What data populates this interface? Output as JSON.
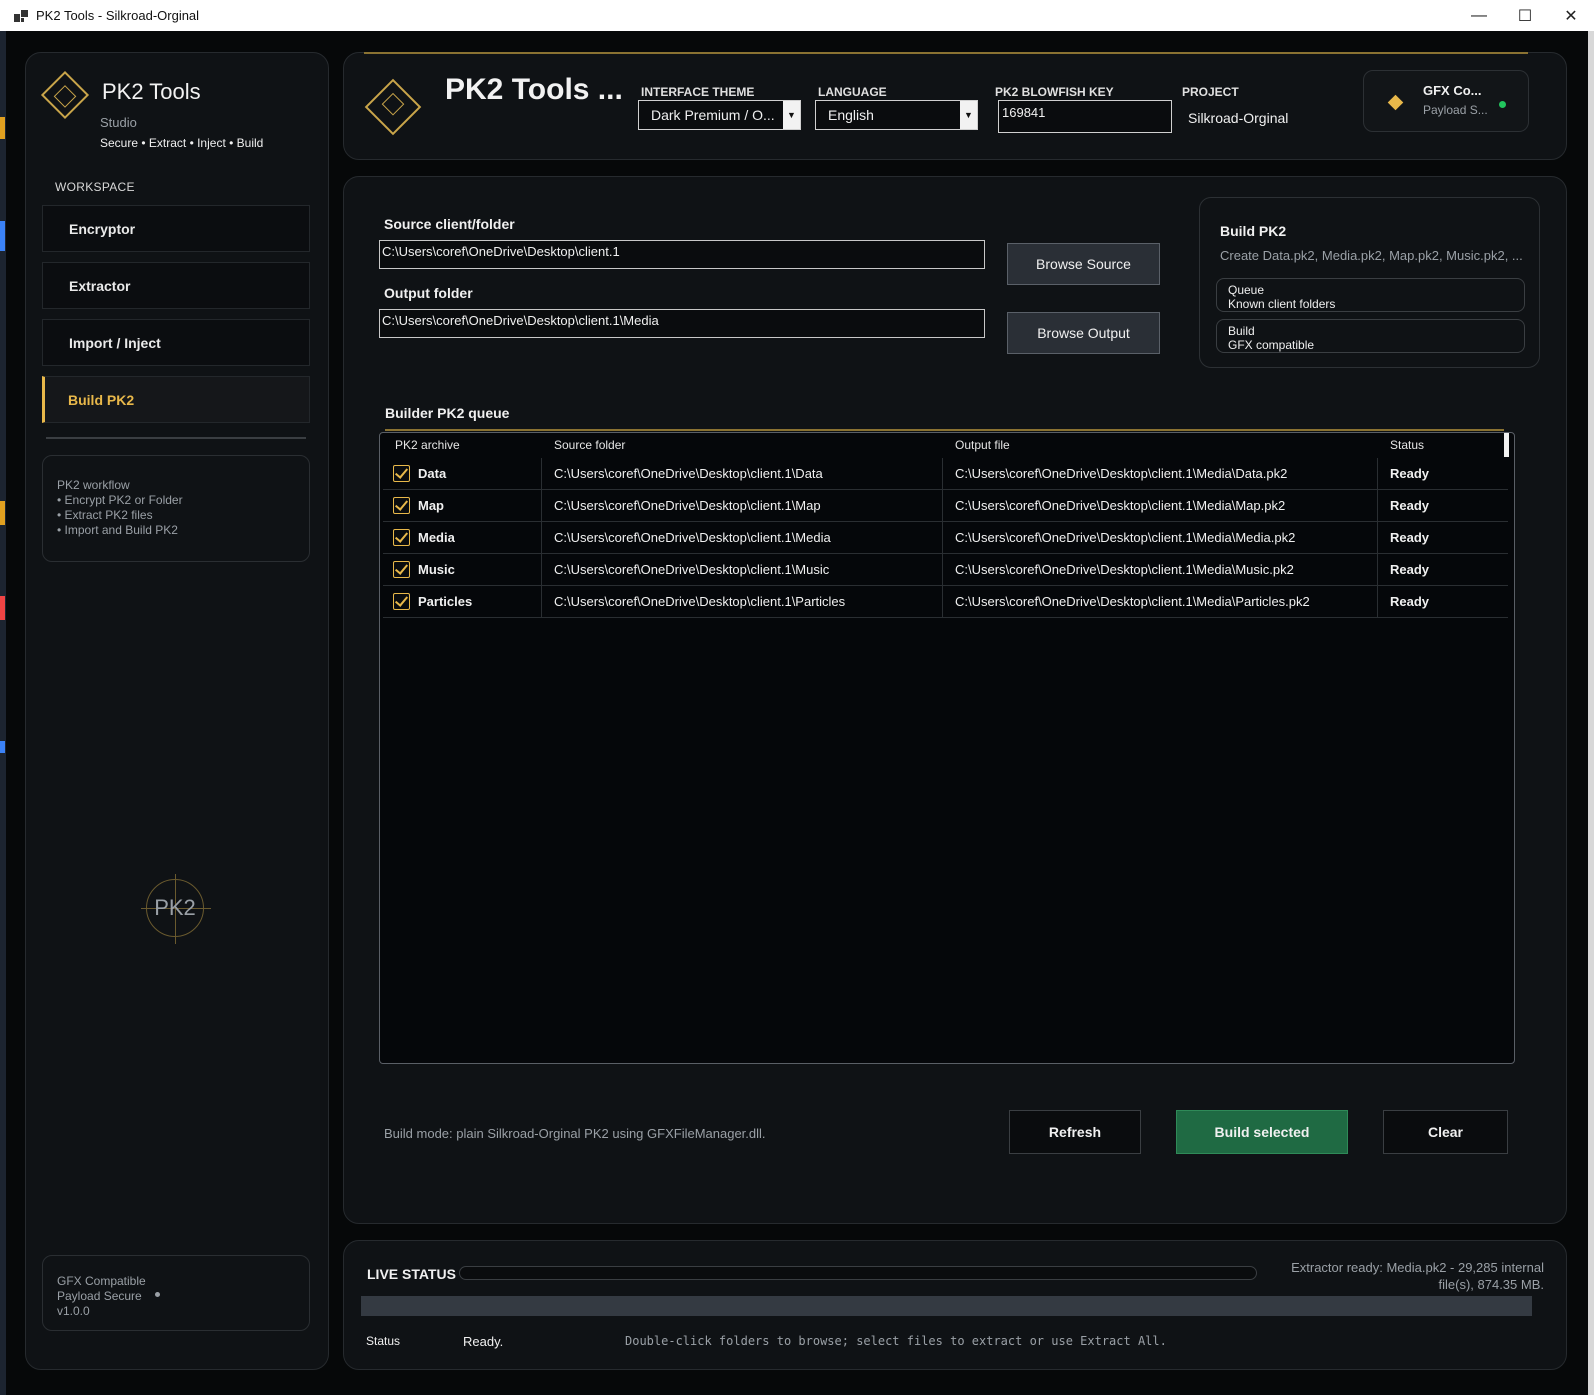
{
  "window": {
    "title": "PK2 Tools - Silkroad-Orginal",
    "minimize": "—",
    "maximize": "☐",
    "close": "✕"
  },
  "sidebar": {
    "app_name": "PK2 Tools",
    "subtitle": "Studio",
    "tagline": "Secure • Extract • Inject • Build",
    "section": "WORKSPACE",
    "items": [
      {
        "label": "Encryptor"
      },
      {
        "label": "Extractor"
      },
      {
        "label": "Import / Inject"
      },
      {
        "label": "Build PK2"
      }
    ],
    "active_index": 3,
    "workflow": [
      "PK2 workflow",
      "• Encrypt PK2 or Folder",
      "• Extract PK2 files",
      "• Import and Build PK2"
    ],
    "mark": "PK2",
    "footer": [
      "GFX Compatible",
      "Payload Secure",
      "v1.0.0"
    ]
  },
  "header": {
    "title": "PK2 Tools ...",
    "theme_label": "INTERFACE THEME",
    "theme_value": "Dark Premium / O...",
    "language_label": "LANGUAGE",
    "language_value": "English",
    "key_label": "PK2 BLOWFISH KEY",
    "key_value": "169841",
    "project_label": "PROJECT",
    "project_value": "Silkroad-Orginal",
    "gfx_title": "GFX Co...",
    "gfx_sub": "Payload S..."
  },
  "main": {
    "source_label": "Source client/folder",
    "source_value": "C:\\Users\\coref\\OneDrive\\Desktop\\client.1",
    "browse_source": "Browse Source",
    "output_label": "Output folder",
    "output_value": "C:\\Users\\coref\\OneDrive\\Desktop\\client.1\\Media",
    "browse_output": "Browse Output",
    "build_card": {
      "title": "Build PK2",
      "subtitle": "Create Data.pk2, Media.pk2, Map.pk2, Music.pk2, ...",
      "pills": [
        {
          "title": "Queue",
          "sub": "Known client folders"
        },
        {
          "title": "Build",
          "sub": "GFX compatible"
        }
      ]
    },
    "queue_title": "Builder PK2 queue",
    "columns": [
      "PK2 archive",
      "Source folder",
      "Output file",
      "Status"
    ],
    "rows": [
      {
        "archive": "Data",
        "source": "C:\\Users\\coref\\OneDrive\\Desktop\\client.1\\Data",
        "output": "C:\\Users\\coref\\OneDrive\\Desktop\\client.1\\Media\\Data.pk2",
        "status": "Ready"
      },
      {
        "archive": "Map",
        "source": "C:\\Users\\coref\\OneDrive\\Desktop\\client.1\\Map",
        "output": "C:\\Users\\coref\\OneDrive\\Desktop\\client.1\\Media\\Map.pk2",
        "status": "Ready"
      },
      {
        "archive": "Media",
        "source": "C:\\Users\\coref\\OneDrive\\Desktop\\client.1\\Media",
        "output": "C:\\Users\\coref\\OneDrive\\Desktop\\client.1\\Media\\Media.pk2",
        "status": "Ready"
      },
      {
        "archive": "Music",
        "source": "C:\\Users\\coref\\OneDrive\\Desktop\\client.1\\Music",
        "output": "C:\\Users\\coref\\OneDrive\\Desktop\\client.1\\Media\\Music.pk2",
        "status": "Ready"
      },
      {
        "archive": "Particles",
        "source": "C:\\Users\\coref\\OneDrive\\Desktop\\client.1\\Particles",
        "output": "C:\\Users\\coref\\OneDrive\\Desktop\\client.1\\Media\\Particles.pk2",
        "status": "Ready"
      }
    ],
    "build_mode": "Build mode: plain Silkroad-Orginal PK2 using GFXFileManager.dll.",
    "refresh": "Refresh",
    "build_selected": "Build selected",
    "clear": "Clear"
  },
  "status": {
    "title": "LIVE STATUS",
    "message": "Extractor ready: Media.pk2 - 29,285 internal file(s), 874.35 MB.",
    "status_label": "Status",
    "status_value": "Ready.",
    "hint": "Double-click folders to browse; select files to extract or use Extract All."
  },
  "colors": {
    "accent": "#e8b84a",
    "primary_button": "#1f6a43",
    "ok_dot": "#22c55e"
  }
}
